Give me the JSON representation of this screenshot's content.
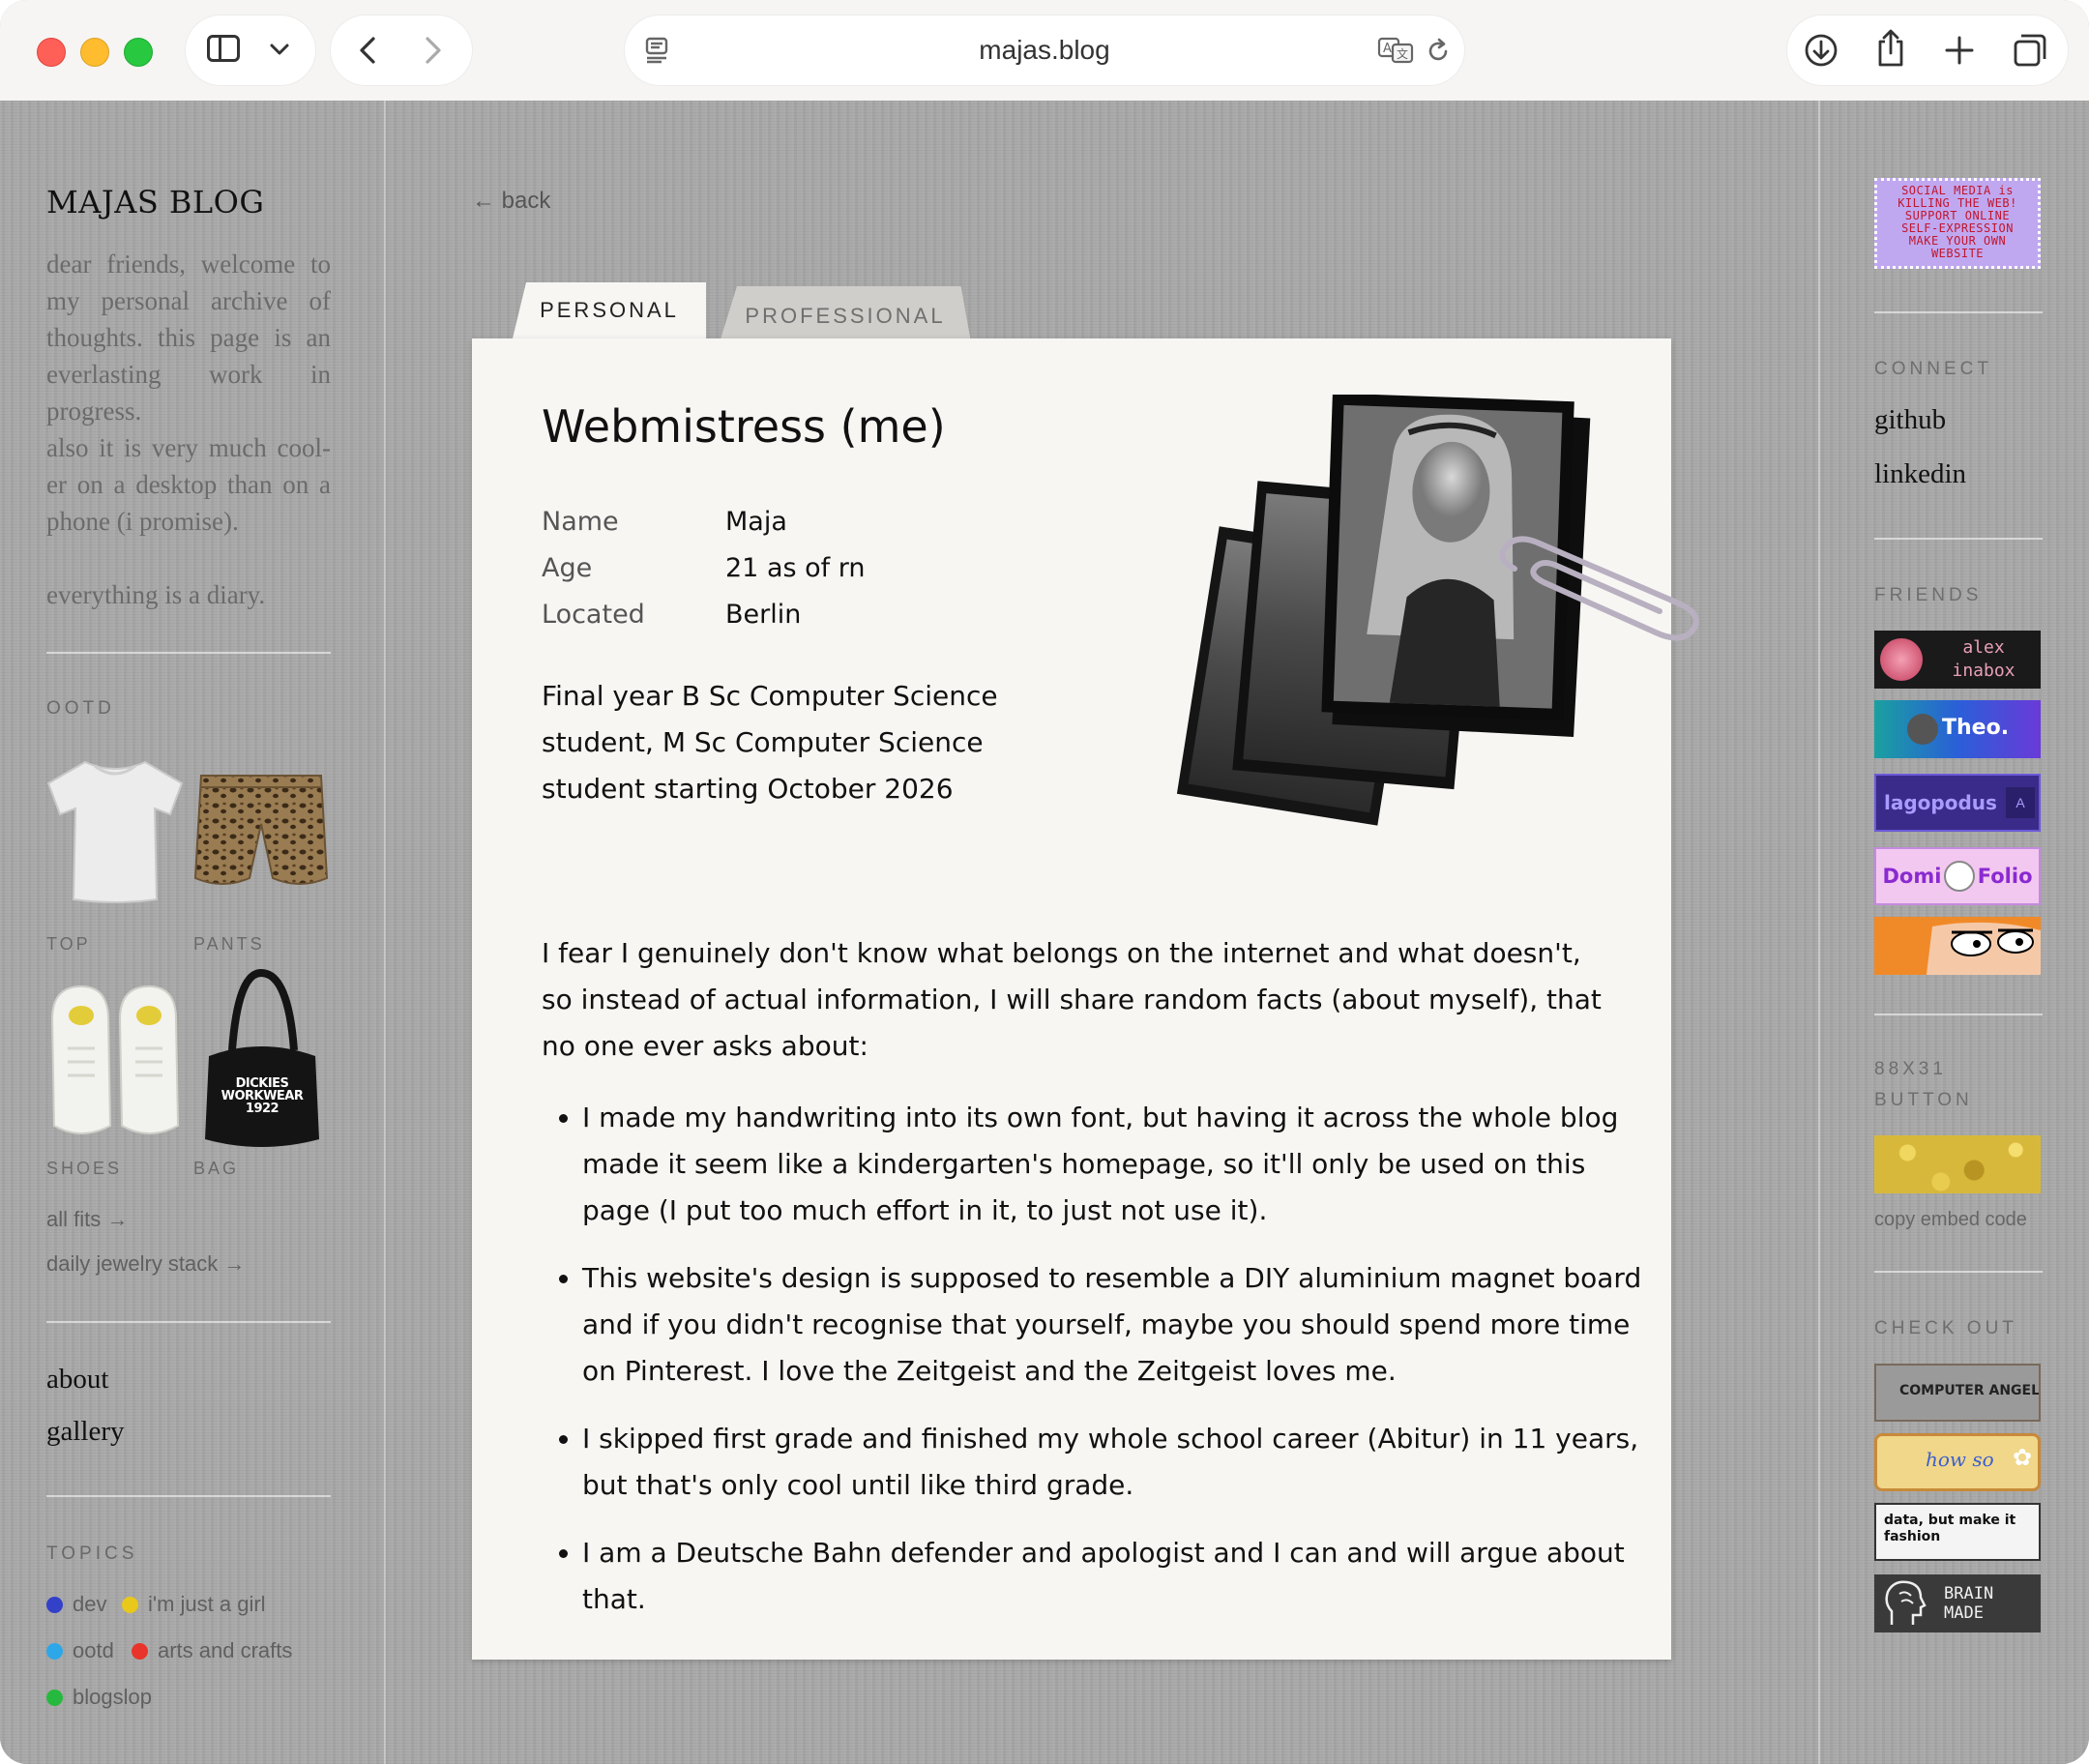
{
  "browser": {
    "url": "majas.blog"
  },
  "left": {
    "blog_title": "MAJAS BLOG",
    "intro_1": "dear friends, welcome to my personal archive of thoughts. this page is an everlasting work in progress.",
    "intro_2": "also it is very much cool-er on a desktop than on a phone (i promise).",
    "intro_3": "everything is a diary.",
    "ootd_label": "OOTD",
    "top_label": "TOP",
    "pants_label": "PANTS",
    "shoes_label": "SHOES",
    "bag_label": "BAG",
    "bag_print": "DICKIES WORKWEAR 1922",
    "all_fits": "all fits →",
    "jewelry": "daily jewelry stack →",
    "about": "about",
    "gallery": "gallery",
    "topics_label": "TOPICS",
    "topics": [
      {
        "name": "dev",
        "color": "#3340c8"
      },
      {
        "name": "i'm just a girl",
        "color": "#e8c81a"
      },
      {
        "name": "ootd",
        "color": "#2ea7e8"
      },
      {
        "name": "arts and crafts",
        "color": "#e8342a"
      },
      {
        "name": "blogslop",
        "color": "#27b93f"
      }
    ]
  },
  "main": {
    "back": "← back",
    "tab_personal": "PERSONAL",
    "tab_professional": "PROFESSIONAL",
    "title": "Webmistress (me)",
    "fields": [
      {
        "key": "Name",
        "value": "Maja"
      },
      {
        "key": "Age",
        "value": "21 as of rn"
      },
      {
        "key": "Located",
        "value": "Berlin"
      }
    ],
    "study": "Final year B Sc Computer Science student, M Sc Computer Science student starting October 2026",
    "intro": "I fear I genuinely don't know what belongs on the internet and what doesn't, so instead of actual information, I will share random facts (about myself), that no one ever asks about:",
    "facts": [
      "I made my handwriting into its own font, but having it across the whole blog made it seem like a kindergarten's homepage, so it'll only be used on this page (I put too much effort in it, to just not use it).",
      "This website's design is supposed to resemble a DIY aluminium magnet board and if you didn't recognise that yourself, maybe you should spend more time on Pinterest. I love the Zeitgeist and the Zeitgeist loves me.",
      "I skipped first grade and finished my whole school career (Abitur) in 11 years, but that's only cool until like third grade.",
      "I am a Deutsche Bahn defender and apologist and I can and will argue about that."
    ]
  },
  "right": {
    "stamp_text": "SOCIAL MEDIA is KILLING THE WEB! SUPPORT ONLINE SELF-EXPRESSION MAKE YOUR OWN WEBSITE",
    "connect_label": "CONNECT",
    "github": "github",
    "linkedin": "linkedin",
    "friends_label": "FRIENDS",
    "friends": [
      {
        "text": "alex inabox",
        "bg": "#1a1a1a",
        "fg": "#e8a0b8"
      },
      {
        "text": "Theo.",
        "bg": "#2a5fd8",
        "fg": "#ffffff"
      },
      {
        "text": "lagopodus",
        "bg": "#3a2a8a",
        "fg": "#a99bff"
      },
      {
        "text": "Domi Folio",
        "bg": "#f3c8f0",
        "fg": "#8a2ad0"
      },
      {
        "text": "",
        "bg": "#f08a28",
        "fg": "#000000"
      }
    ],
    "button_label": "88X31 BUTTON",
    "copy_embed": "copy embed code",
    "check_label": "CHECK OUT",
    "checks": [
      {
        "text": "COMPUTER ANGEL",
        "bg": "#9a9a9a",
        "fg": "#222222"
      },
      {
        "text": "how so",
        "bg": "#f1d78a",
        "fg": "#3a5fd0"
      },
      {
        "text": "data, but make it fashion",
        "bg": "#f4f4f4",
        "fg": "#111111"
      },
      {
        "text": "BRAIN MADE",
        "bg": "#3a3a3a",
        "fg": "#f0f0f0"
      }
    ]
  }
}
